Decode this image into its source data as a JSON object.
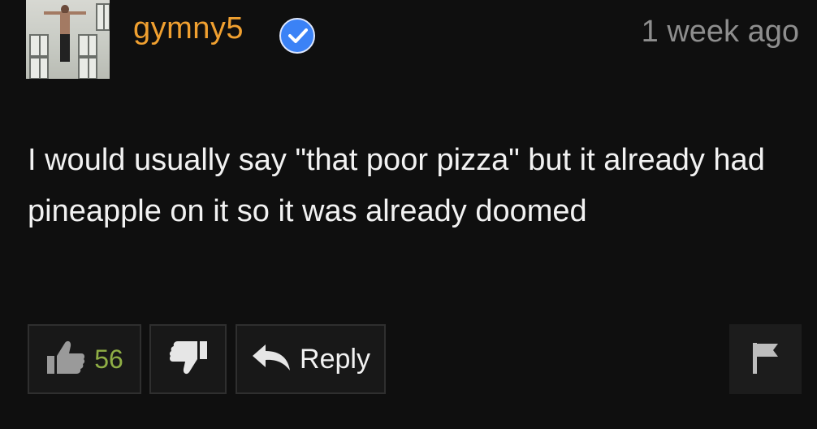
{
  "comment": {
    "username": "gymny5",
    "verified": true,
    "timestamp": "1 week ago",
    "text": "I would usually say \"that poor pizza\" but it already had pineapple on it so it was already doomed"
  },
  "actions": {
    "like_count": "56",
    "reply_label": "Reply"
  },
  "colors": {
    "background": "#0f0f0f",
    "username": "#f0a030",
    "verified_badge": "#3b82f6",
    "like_count": "#8fae45",
    "timestamp": "#8e8e8e",
    "text": "#f2f2f2"
  },
  "icons": {
    "verified": "check-badge-icon",
    "like": "thumbs-up-icon",
    "dislike": "thumbs-down-icon",
    "reply": "reply-arrow-icon",
    "flag": "flag-icon"
  }
}
